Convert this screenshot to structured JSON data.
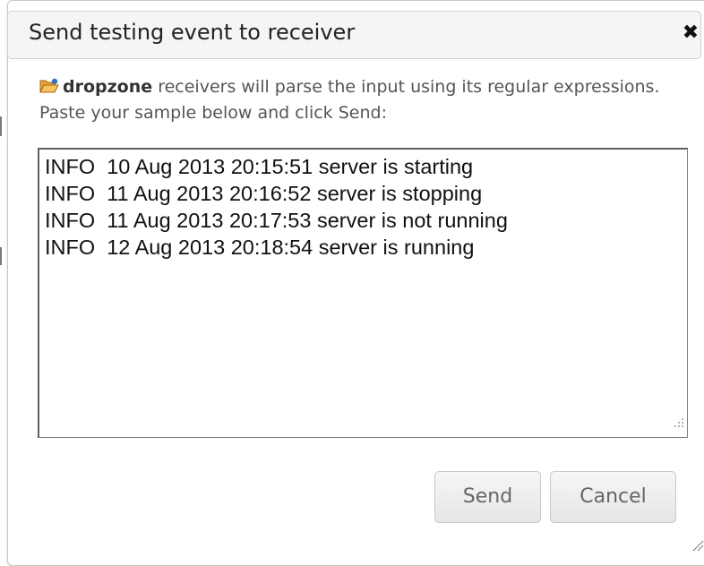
{
  "dialog": {
    "title": "Send testing event to receiver",
    "close_icon": "close-icon",
    "close_glyph": "✖"
  },
  "intro": {
    "icon": "folder-open-icon",
    "receiver_name": "dropzone",
    "text": " receivers will parse the input using its regular expressions. Paste your sample below and click Send:"
  },
  "sample": {
    "value": "INFO  10 Aug 2013 20:15:51 server is starting\nINFO  11 Aug 2013 20:16:52 server is stopping\nINFO  11 Aug 2013 20:17:53 server is not running\nINFO  12 Aug 2013 20:18:54 server is running"
  },
  "buttons": {
    "send_label": "Send",
    "cancel_label": "Cancel"
  },
  "colors": {
    "header_bg": "#f5f5f5",
    "folder_icon_orange": "#e8a33d",
    "folder_icon_blue": "#3b6fb6"
  }
}
